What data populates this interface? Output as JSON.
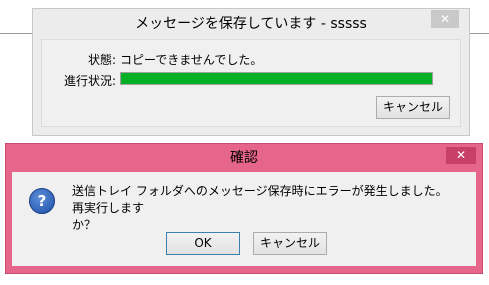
{
  "progress_dialog": {
    "title": "メッセージを保存しています - sssss",
    "close_glyph": "✕",
    "status_label": "状態:",
    "status_value": "コピーできませんでした。",
    "progress_label": "進行状況:",
    "progress_fraction": 1.0,
    "cancel_label": "キャンセル"
  },
  "confirm_dialog": {
    "title": "確認",
    "close_glyph": "✕",
    "icon": "question-icon",
    "icon_glyph": "?",
    "message_line1": "送信トレイ フォルダへのメッセージ保存時にエラーが発生しました。再実行します",
    "message_line2": "か？",
    "ok_label": "OK",
    "cancel_label": "キャンセル"
  },
  "colors": {
    "confirm_frame": "#e6658a",
    "progress_fill": "#06b025"
  }
}
